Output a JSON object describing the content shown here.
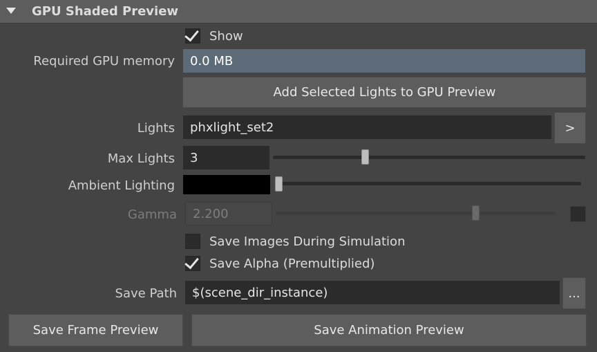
{
  "section": {
    "title": "GPU Shaded Preview"
  },
  "show": {
    "label": "Show",
    "checked": true
  },
  "gpu_memory": {
    "label": "Required GPU memory",
    "value": "0.0 MB"
  },
  "add_lights_button": "Add Selected Lights to GPU Preview",
  "lights": {
    "label": "Lights",
    "value": "phxlight_set2",
    "button": ">"
  },
  "max_lights": {
    "label": "Max Lights",
    "value": "3",
    "slider_fraction": 0.29
  },
  "ambient": {
    "label": "Ambient Lighting",
    "color": "#000000",
    "slider_fraction": 0.0
  },
  "gamma": {
    "label": "Gamma",
    "value": "2.200",
    "slider_fraction": 0.72,
    "enabled": false
  },
  "save_images": {
    "label": "Save Images During Simulation",
    "checked": false
  },
  "save_alpha": {
    "label": "Save Alpha (Premultiplied)",
    "checked": true
  },
  "save_path": {
    "label": "Save Path",
    "value": "$(scene_dir_instance)",
    "button": "..."
  },
  "footer": {
    "save_frame": "Save Frame Preview",
    "save_animation": "Save Animation Preview"
  }
}
